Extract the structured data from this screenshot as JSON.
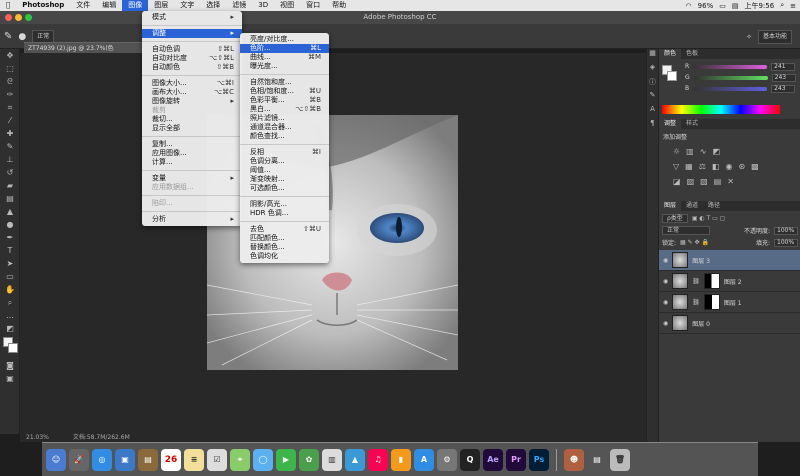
{
  "menubar": {
    "app": "Photoshop",
    "items": [
      "文件",
      "编辑",
      "图像",
      "图层",
      "文字",
      "选择",
      "滤镜",
      "3D",
      "视图",
      "窗口",
      "帮助"
    ],
    "active_index": 2,
    "battery": "96%",
    "time": "上午9:56"
  },
  "window": {
    "title": "Adobe Photoshop CC"
  },
  "options": {
    "mode_label": "正常",
    "workspace": "基本功能"
  },
  "doc_tab": "ZT74939 (2).jpg @ 23.7%(色",
  "status": {
    "zoom": "21.03%",
    "doc_size": "文档:58.7M/262.6M"
  },
  "image_menu": {
    "items": [
      {
        "label": "模式",
        "shortcut": "▸",
        "type": "normal"
      },
      {
        "type": "sep"
      },
      {
        "label": "调整",
        "shortcut": "▸",
        "type": "hl"
      },
      {
        "type": "sep"
      },
      {
        "label": "自动色调",
        "shortcut": "⇧⌘L",
        "type": "normal"
      },
      {
        "label": "自动对比度",
        "shortcut": "⌥⇧⌘L",
        "type": "normal"
      },
      {
        "label": "自动颜色",
        "shortcut": "⇧⌘B",
        "type": "normal"
      },
      {
        "type": "sep"
      },
      {
        "label": "图像大小...",
        "shortcut": "⌥⌘I",
        "type": "normal"
      },
      {
        "label": "画布大小...",
        "shortcut": "⌥⌘C",
        "type": "normal"
      },
      {
        "label": "图像旋转",
        "shortcut": "▸",
        "type": "normal"
      },
      {
        "label": "裁剪",
        "shortcut": "",
        "type": "dis"
      },
      {
        "label": "裁切...",
        "shortcut": "",
        "type": "normal"
      },
      {
        "label": "显示全部",
        "shortcut": "",
        "type": "normal"
      },
      {
        "type": "sep"
      },
      {
        "label": "复制...",
        "shortcut": "",
        "type": "normal"
      },
      {
        "label": "应用图像...",
        "shortcut": "",
        "type": "normal"
      },
      {
        "label": "计算...",
        "shortcut": "",
        "type": "normal"
      },
      {
        "type": "sep"
      },
      {
        "label": "变量",
        "shortcut": "▸",
        "type": "normal"
      },
      {
        "label": "应用数据组...",
        "shortcut": "",
        "type": "dis"
      },
      {
        "type": "sep"
      },
      {
        "label": "陷印...",
        "shortcut": "",
        "type": "dis"
      },
      {
        "type": "sep"
      },
      {
        "label": "分析",
        "shortcut": "▸",
        "type": "normal"
      }
    ]
  },
  "adjust_menu": {
    "items": [
      {
        "label": "亮度/对比度...",
        "shortcut": "",
        "type": "normal"
      },
      {
        "label": "色阶...",
        "shortcut": "⌘L",
        "type": "hl"
      },
      {
        "label": "曲线...",
        "shortcut": "⌘M",
        "type": "normal"
      },
      {
        "label": "曝光度...",
        "shortcut": "",
        "type": "normal"
      },
      {
        "type": "sep"
      },
      {
        "label": "自然饱和度...",
        "shortcut": "",
        "type": "normal"
      },
      {
        "label": "色相/饱和度...",
        "shortcut": "⌘U",
        "type": "normal"
      },
      {
        "label": "色彩平衡...",
        "shortcut": "⌘B",
        "type": "normal"
      },
      {
        "label": "黑白...",
        "shortcut": "⌥⇧⌘B",
        "type": "normal"
      },
      {
        "label": "照片滤镜...",
        "shortcut": "",
        "type": "normal"
      },
      {
        "label": "通道混合器...",
        "shortcut": "",
        "type": "normal"
      },
      {
        "label": "颜色查找...",
        "shortcut": "",
        "type": "normal"
      },
      {
        "type": "sep"
      },
      {
        "label": "反相",
        "shortcut": "⌘I",
        "type": "normal"
      },
      {
        "label": "色调分离...",
        "shortcut": "",
        "type": "normal"
      },
      {
        "label": "阈值...",
        "shortcut": "",
        "type": "normal"
      },
      {
        "label": "渐变映射...",
        "shortcut": "",
        "type": "normal"
      },
      {
        "label": "可选颜色...",
        "shortcut": "",
        "type": "normal"
      },
      {
        "type": "sep"
      },
      {
        "label": "阴影/高光...",
        "shortcut": "",
        "type": "normal"
      },
      {
        "label": "HDR 色调...",
        "shortcut": "",
        "type": "normal"
      },
      {
        "type": "sep"
      },
      {
        "label": "去色",
        "shortcut": "⇧⌘U",
        "type": "normal"
      },
      {
        "label": "匹配颜色...",
        "shortcut": "",
        "type": "normal"
      },
      {
        "label": "替换颜色...",
        "shortcut": "",
        "type": "normal"
      },
      {
        "label": "色调均化",
        "shortcut": "",
        "type": "normal"
      }
    ]
  },
  "color_panel": {
    "tabs": [
      "颜色",
      "色板"
    ],
    "channels": [
      {
        "label": "R",
        "value": "241",
        "color": "#e060e0"
      },
      {
        "label": "G",
        "value": "243",
        "color": "#60e060"
      },
      {
        "label": "B",
        "value": "243",
        "color": "#6060e0"
      }
    ]
  },
  "adjust_panel": {
    "tabs": [
      "调整",
      "样式"
    ],
    "title": "添加调整"
  },
  "layers_panel": {
    "tabs": [
      "图层",
      "通道",
      "路径"
    ],
    "kind": "ρ类型",
    "blend": "正常",
    "opacity_label": "不透明度:",
    "opacity": "100%",
    "lock_label": "锁定:",
    "fill_label": "填充:",
    "fill": "100%",
    "layers": [
      {
        "name": "图层 3",
        "selected": true
      },
      {
        "name": "图层 2",
        "selected": false
      },
      {
        "name": "图层 1",
        "selected": false
      },
      {
        "name": "图层 0",
        "selected": false
      }
    ]
  },
  "dock": {
    "date": "26"
  }
}
